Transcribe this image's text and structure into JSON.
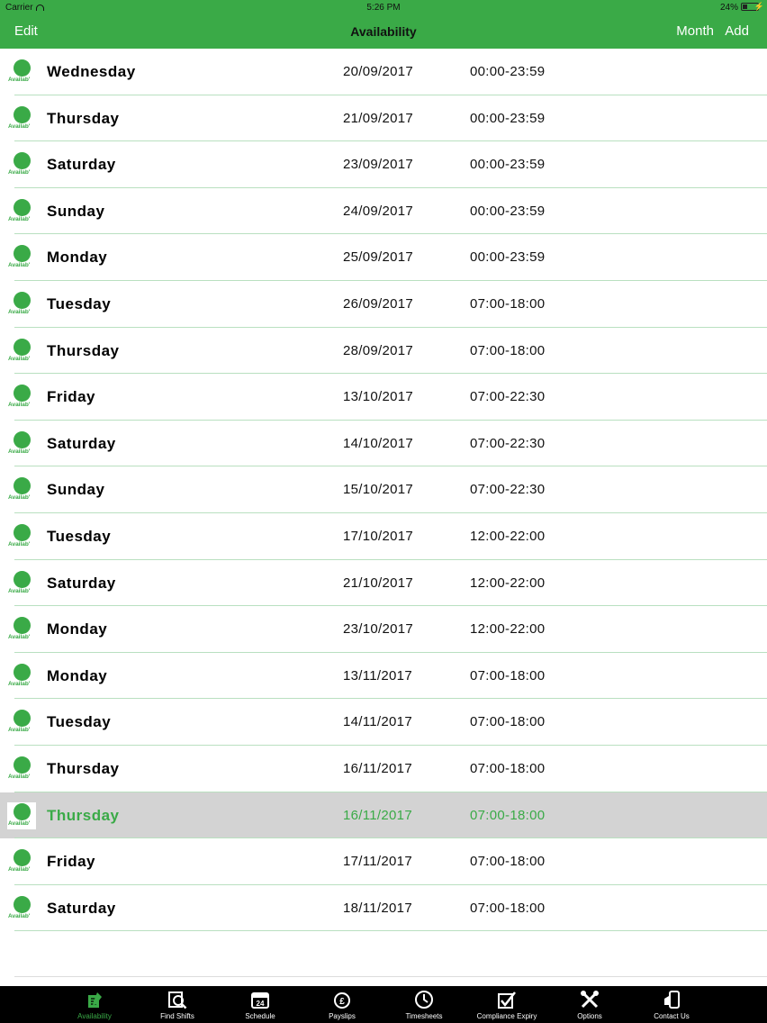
{
  "status_bar": {
    "carrier": "Carrier",
    "time": "5:26 PM",
    "battery": "24%"
  },
  "nav": {
    "left": "Edit",
    "title": "Availability",
    "month": "Month",
    "add": "Add"
  },
  "icon_label": "Availab'",
  "rows": [
    {
      "day": "Wednesday",
      "date": "20/09/2017",
      "hours": "00:00-23:59"
    },
    {
      "day": "Thursday",
      "date": "21/09/2017",
      "hours": "00:00-23:59"
    },
    {
      "day": "Saturday",
      "date": "23/09/2017",
      "hours": "00:00-23:59"
    },
    {
      "day": "Sunday",
      "date": "24/09/2017",
      "hours": "00:00-23:59"
    },
    {
      "day": "Monday",
      "date": "25/09/2017",
      "hours": "00:00-23:59"
    },
    {
      "day": "Tuesday",
      "date": "26/09/2017",
      "hours": "07:00-18:00"
    },
    {
      "day": "Thursday",
      "date": "28/09/2017",
      "hours": "07:00-18:00"
    },
    {
      "day": "Friday",
      "date": "13/10/2017",
      "hours": "07:00-22:30"
    },
    {
      "day": "Saturday",
      "date": "14/10/2017",
      "hours": "07:00-22:30"
    },
    {
      "day": "Sunday",
      "date": "15/10/2017",
      "hours": "07:00-22:30"
    },
    {
      "day": "Tuesday",
      "date": "17/10/2017",
      "hours": "12:00-22:00"
    },
    {
      "day": "Saturday",
      "date": "21/10/2017",
      "hours": "12:00-22:00"
    },
    {
      "day": "Monday",
      "date": "23/10/2017",
      "hours": "12:00-22:00"
    },
    {
      "day": "Monday",
      "date": "13/11/2017",
      "hours": "07:00-18:00"
    },
    {
      "day": "Tuesday",
      "date": "14/11/2017",
      "hours": "07:00-18:00"
    },
    {
      "day": "Thursday",
      "date": "16/11/2017",
      "hours": "07:00-18:00"
    },
    {
      "day": "Thursday",
      "date": "16/11/2017",
      "hours": "07:00-18:00",
      "selected": true
    },
    {
      "day": "Friday",
      "date": "17/11/2017",
      "hours": "07:00-18:00"
    },
    {
      "day": "Saturday",
      "date": "18/11/2017",
      "hours": "07:00-18:00"
    }
  ],
  "tabs": [
    {
      "label": "Availability",
      "icon": "availability-icon",
      "active": true
    },
    {
      "label": "Find Shifts",
      "icon": "find-shifts-icon"
    },
    {
      "label": "Schedule",
      "icon": "calendar-icon"
    },
    {
      "label": "Payslips",
      "icon": "payslips-icon"
    },
    {
      "label": "Timesheets",
      "icon": "clock-icon"
    },
    {
      "label": "Compliance Expiry",
      "icon": "checkbox-icon"
    },
    {
      "label": "Options",
      "icon": "tools-icon"
    },
    {
      "label": "Contact Us",
      "icon": "phone-icon"
    }
  ],
  "colors": {
    "accent": "#3aaa47",
    "selected_row": "#d3d3d3",
    "tabbar": "#000000"
  }
}
